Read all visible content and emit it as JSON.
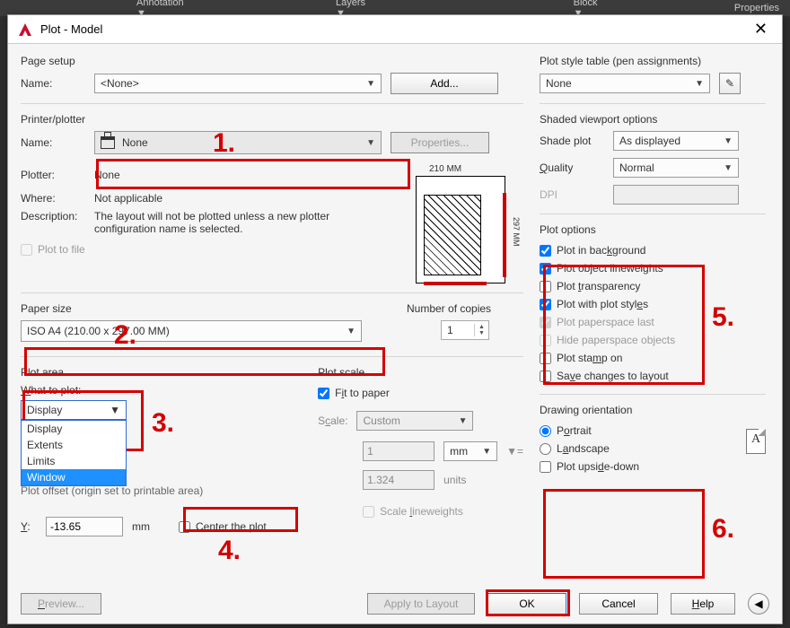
{
  "menubar": {
    "items": [
      "Annotation ▼",
      "Layers ▼",
      "Block ▼",
      "Properties"
    ]
  },
  "window": {
    "title": "Plot - Model"
  },
  "pageSetup": {
    "section": "Page setup",
    "nameLabel": "Name:",
    "nameValue": "<None>",
    "addBtn": "Add..."
  },
  "printer": {
    "section": "Printer/plotter",
    "nameLabel": "Name:",
    "nameValue": "None",
    "propertiesBtn": "Properties...",
    "plotterLabel": "Plotter:",
    "plotterValue": "None",
    "whereLabel": "Where:",
    "whereValue": "Not applicable",
    "descLabel": "Description:",
    "descValue": "The layout will not be plotted unless a new plotter configuration name is selected.",
    "plotToFile": "Plot to file",
    "previewTop": "210 MM",
    "previewSide": "297 MM"
  },
  "paper": {
    "section": "Paper size",
    "value": "ISO A4 (210.00 x 297.00 MM)",
    "copiesLabel": "Number of copies",
    "copies": "1"
  },
  "plotArea": {
    "section": "Plot area",
    "whatLabel": "What to plot:",
    "selected": "Display",
    "options": [
      "Display",
      "Extents",
      "Limits",
      "Window"
    ],
    "highlighted": "Window",
    "offsetSection": "Plot offset (origin set to printable area)",
    "yLabel": "Y:",
    "yValue": "-13.65",
    "yUnit": "mm",
    "centerPlot": "Center the plot"
  },
  "plotScale": {
    "section": "Plot scale",
    "fitToPaper": "Fit to paper",
    "scaleLabel": "Scale:",
    "scaleValue": "Custom",
    "num": "1",
    "unit": "mm",
    "denom": "1.324",
    "denomUnit": "units",
    "scaleLW": "Scale lineweights"
  },
  "styleTable": {
    "section": "Plot style table (pen assignments)",
    "value": "None"
  },
  "shaded": {
    "section": "Shaded viewport options",
    "shadeLabel": "Shade plot",
    "shadeValue": "As displayed",
    "qualityLabel": "Quality",
    "qualityValue": "Normal",
    "dpiLabel": "DPI"
  },
  "options": {
    "section": "Plot options",
    "bg": "Plot in background",
    "lw": "Plot object lineweights",
    "trans": "Plot transparency",
    "styles": "Plot with plot styles",
    "ps": "Plot paperspace last",
    "hide": "Hide paperspace objects",
    "stamp": "Plot stamp on",
    "save": "Save changes to layout"
  },
  "orient": {
    "section": "Drawing orientation",
    "portrait": "Portrait",
    "landscape": "Landscape",
    "upside": "Plot upside-down"
  },
  "footer": {
    "preview": "Preview...",
    "apply": "Apply to Layout",
    "ok": "OK",
    "cancel": "Cancel",
    "help": "Help"
  },
  "annotations": {
    "n1": "1.",
    "n2": "2.",
    "n3": "3.",
    "n4": "4.",
    "n5": "5.",
    "n6": "6."
  }
}
